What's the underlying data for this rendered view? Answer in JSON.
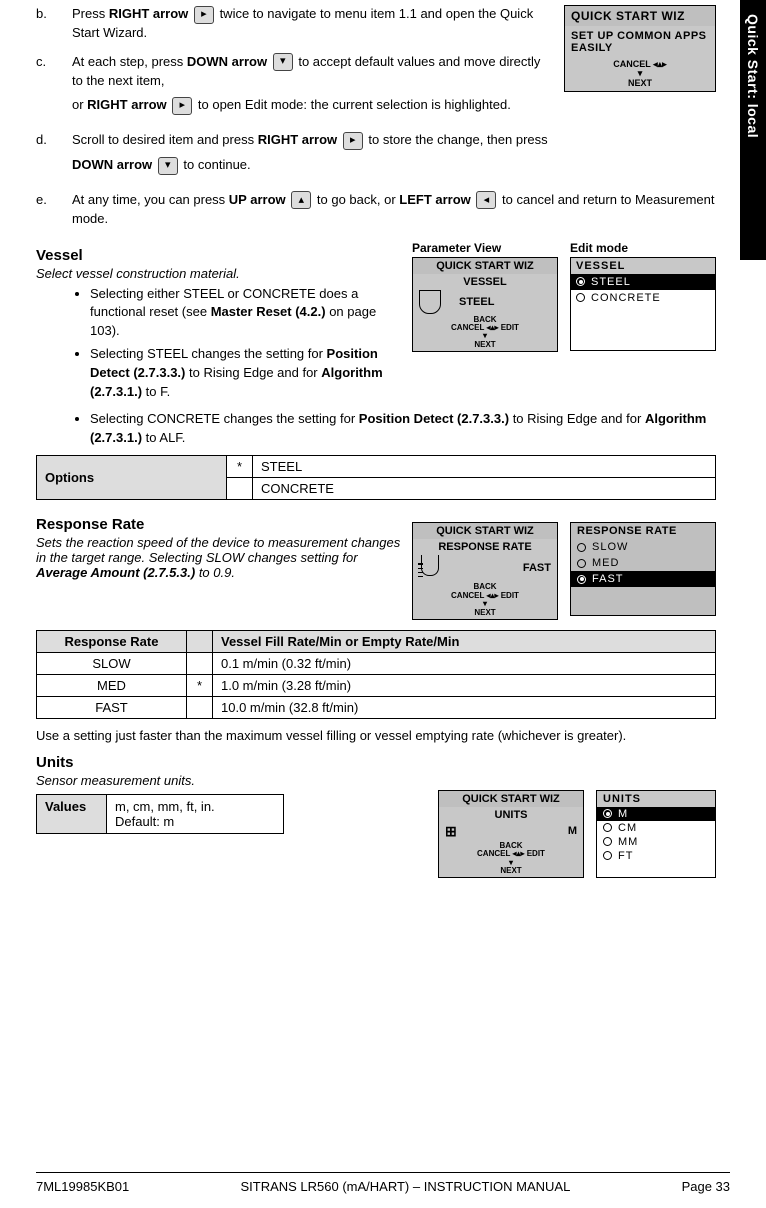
{
  "sideTab": "Quick Start: local",
  "steps": {
    "b": {
      "letter": "b.",
      "pre": "Press ",
      "key1": "RIGHT arrow",
      "icon1": "▸",
      "post": " twice to navigate to menu item 1.1 and open the Quick Start Wizard."
    },
    "c": {
      "letter": "c.",
      "l1_pre": "At each step, press ",
      "l1_key": "DOWN arrow",
      "l1_icon": "▾",
      "l1_post": " to accept default values and move directly to the next item,",
      "l2_pre": "or ",
      "l2_key": "RIGHT arrow",
      "l2_icon": "▸",
      "l2_post": " to open Edit mode: the current selection is highlighted."
    },
    "d": {
      "letter": "d.",
      "l1_pre": "Scroll to desired item and press ",
      "l1_key": "RIGHT arrow",
      "l1_icon": "▸",
      "l1_post": " to store the change, then press ",
      "l2_key": "DOWN arrow",
      "l2_icon": "▾",
      "l2_post": " to continue."
    },
    "e": {
      "letter": "e.",
      "pre": "At any time, you can press ",
      "key1": "UP arrow",
      "icon1": "▴",
      "mid": " to go back, or ",
      "key2": "LEFT arrow",
      "icon2": "◂",
      "post": " to cancel and return to Measurement mode."
    }
  },
  "topPanel": {
    "title": "QUICK START WIZ",
    "body": "SET UP COMMON APPS EASILY",
    "cancel": "CANCEL",
    "next": "NEXT"
  },
  "vessel": {
    "heading": "Vessel",
    "sub": "Select vessel construction material.",
    "b1_pre": "Selecting either STEEL or CONCRETE does a functional reset (see ",
    "b1_bold": "Master Reset (4.2.)",
    "b1_post": " on page 103).",
    "b2_pre": "Selecting STEEL changes the setting for ",
    "b2_bold1": "Position Detect (2.7.3.3.)",
    "b2_mid": " to Rising Edge and for ",
    "b2_bold2": "Algorithm (2.7.3.1.)",
    "b2_post": " to F.",
    "b3_pre": "Selecting CONCRETE changes the setting for ",
    "b3_bold1": "Position Detect (2.7.3.3.)",
    "b3_mid": " to Rising Edge and for ",
    "b3_bold2": "Algorithm (2.7.3.1.)",
    "b3_post": " to ALF.",
    "paramLabel": "Parameter View",
    "editLabel": "Edit mode",
    "paramPanel": {
      "title": "QUICK START WIZ",
      "param": "VESSEL",
      "value": "STEEL",
      "back": "BACK",
      "cancel": "CANCEL",
      "edit": "EDIT",
      "next": "NEXT"
    },
    "editPanel": {
      "title": "VESSEL",
      "opt1": "STEEL",
      "opt2": "CONCRETE"
    },
    "optionsHeader": "Options",
    "star": "*",
    "opt1": "STEEL",
    "opt2": "CONCRETE"
  },
  "response": {
    "heading": "Response Rate",
    "sub_pre": "Sets the reaction speed of the device to measurement changes in the target range. Selecting SLOW changes setting for ",
    "sub_bold": "Average Amount (2.7.5.3.)",
    "sub_post": " to 0.9.",
    "paramPanel": {
      "title": "QUICK START WIZ",
      "param": "RESPONSE RATE",
      "value": "FAST",
      "back": "BACK",
      "cancel": "CANCEL",
      "edit": "EDIT",
      "next": "NEXT"
    },
    "editPanel": {
      "title": "RESPONSE RATE",
      "opt1": "SLOW",
      "opt2": "MED",
      "opt3": "FAST"
    },
    "tableHead1": "Response Rate",
    "tableHead2": "Vessel Fill Rate/Min or Empty Rate/Min",
    "row1": {
      "rate": "SLOW",
      "star": "",
      "val": "0.1 m/min (0.32 ft/min)"
    },
    "row2": {
      "rate": "MED",
      "star": "*",
      "val": "1.0 m/min (3.28 ft/min)"
    },
    "row3": {
      "rate": "FAST",
      "star": "",
      "val": "10.0 m/min (32.8 ft/min)"
    },
    "note": "Use a setting just faster than the maximum vessel filling or vessel emptying rate (whichever is greater)."
  },
  "units": {
    "heading": "Units",
    "sub": "Sensor measurement units.",
    "valHeader": "Values",
    "valText": "m, cm, mm, ft, in.",
    "valDefault": "Default: m",
    "paramPanel": {
      "title": "QUICK START WIZ",
      "param": "UNITS",
      "value": "M",
      "back": "BACK",
      "cancel": "CANCEL",
      "edit": "EDIT",
      "next": "NEXT"
    },
    "editPanel": {
      "title": "UNITS",
      "opt1": "M",
      "opt2": "CM",
      "opt3": "MM",
      "opt4": "FT"
    }
  },
  "footer": {
    "left": "7ML19985KB01",
    "center": "SITRANS LR560 (mA/HART) – INSTRUCTION MANUAL",
    "right": "Page 33"
  }
}
